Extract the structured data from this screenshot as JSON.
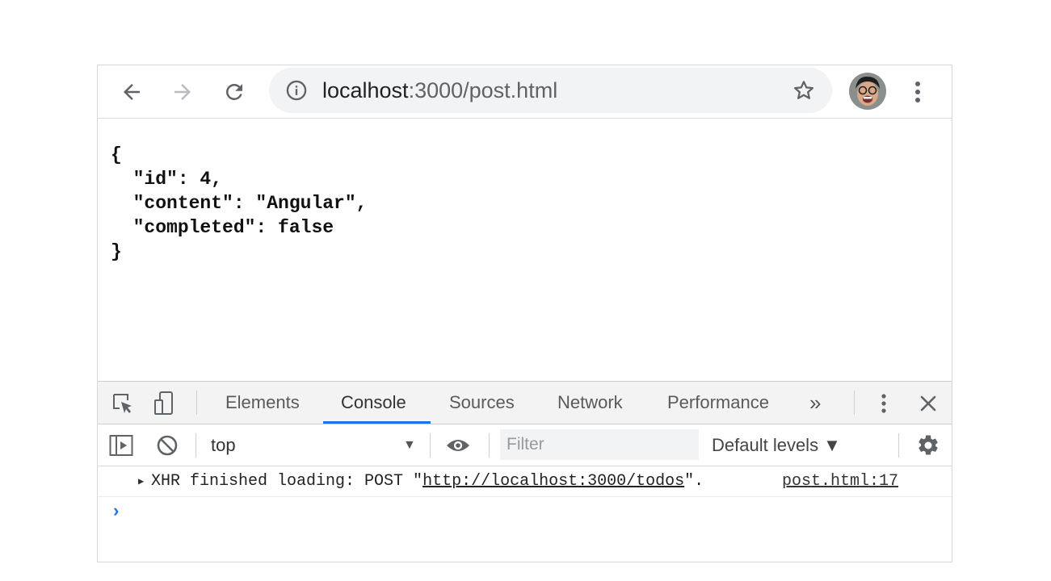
{
  "toolbar": {
    "url_host": "localhost",
    "url_path": ":3000/post.html",
    "back_icon": "back-arrow-icon",
    "forward_icon": "forward-arrow-icon",
    "reload_icon": "reload-icon",
    "info_icon": "info-icon",
    "star_icon": "star-icon",
    "menu_icon": "vertical-dots-icon"
  },
  "page": {
    "json_lines": [
      "{",
      "  \"id\": 4,",
      "  \"content\": \"Angular\",",
      "  \"completed\": false",
      "}"
    ]
  },
  "devtools": {
    "tabs": [
      {
        "label": "Elements",
        "active": false
      },
      {
        "label": "Console",
        "active": true
      },
      {
        "label": "Sources",
        "active": false
      },
      {
        "label": "Network",
        "active": false
      },
      {
        "label": "Performance",
        "active": false
      }
    ],
    "more_tabs": "»",
    "context": "top",
    "context_caret": "▼",
    "filter_placeholder": "Filter",
    "levels": "Default levels ▼",
    "accent_color": "#1a73e8"
  },
  "console": {
    "messages": [
      {
        "prefix": "XHR finished loading: POST \"",
        "url": "http://localhost:3000/todos",
        "suffix": "\".",
        "source": "post.html:17"
      }
    ],
    "prompt": "›"
  }
}
